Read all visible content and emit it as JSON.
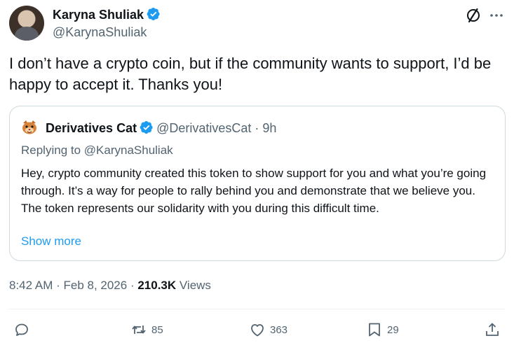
{
  "author": {
    "name": "Karyna Shuliak",
    "handle": "@KarynaShuliak"
  },
  "tweet": {
    "text": "I don’t have a crypto coin, but if the community wants to support, I’d be happy to accept it.  Thanks you!"
  },
  "quoted": {
    "name": "Derivatives Cat",
    "handle_time": "@DerivativesCat · 9h",
    "replying_prefix": "Replying to ",
    "replying_to": "@KarynaShuliak",
    "text": "Hey, crypto community created this token to show support for you and what you’re going through. It’s a way for people to rally behind you and demonstrate that we believe you. The token represents our solidarity with you during this difficult time.",
    "show_more": "Show more"
  },
  "meta": {
    "timestamp": "8:42 AM · Feb 8, 2026",
    "separator": " · ",
    "views_count": "210.3K",
    "views_label": " Views"
  },
  "actions": {
    "reply_count": "",
    "repost_count": "85",
    "like_count": "363",
    "bookmark_count": "29"
  },
  "colors": {
    "accent": "#1d9bf0",
    "text": "#0f1419",
    "secondary": "#536471",
    "border": "#cfd9de"
  },
  "icons": [
    "verified-badge-icon",
    "grok-icon",
    "more-icon",
    "reply-icon",
    "repost-icon",
    "like-icon",
    "bookmark-icon",
    "share-icon"
  ]
}
